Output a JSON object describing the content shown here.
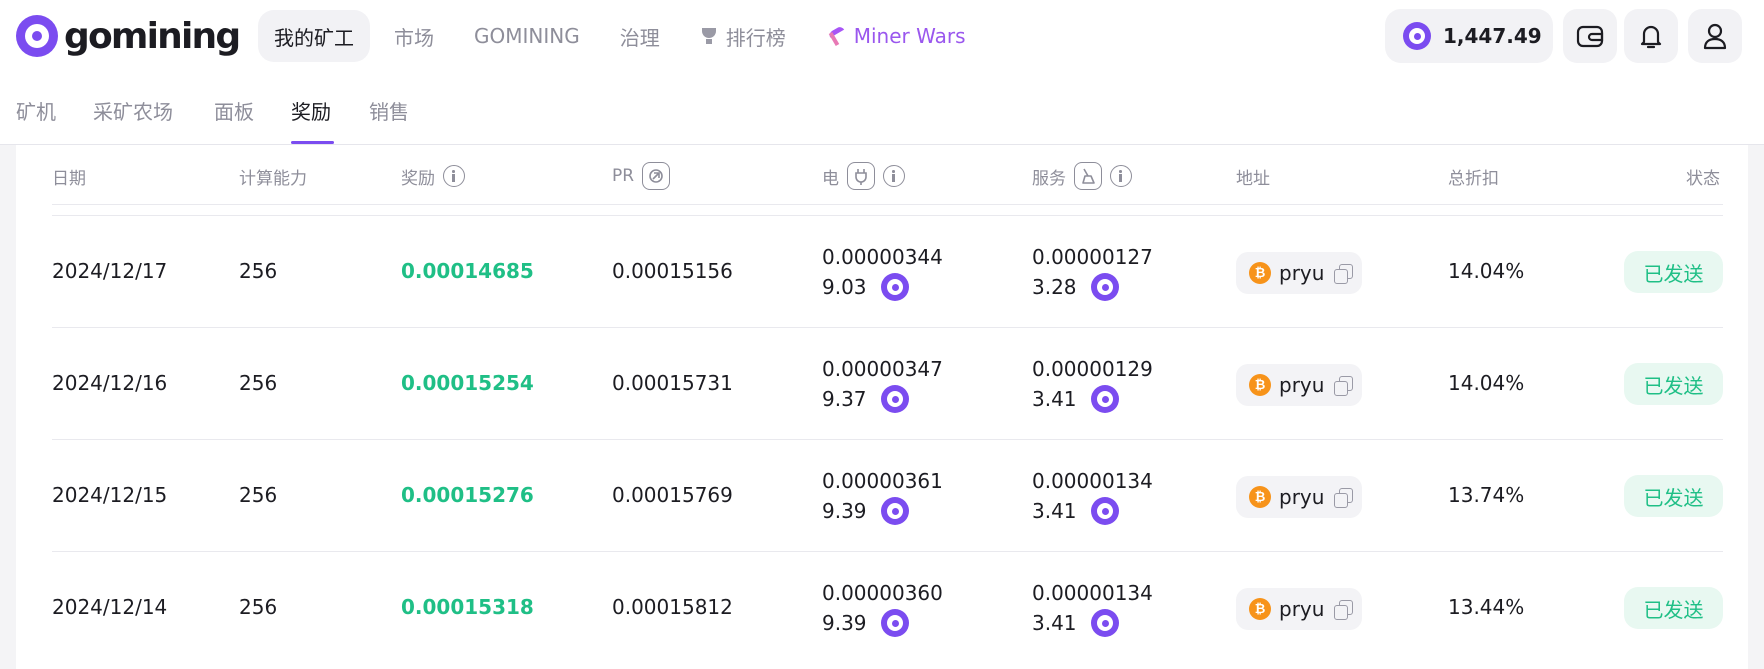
{
  "brand": {
    "name": "gomining"
  },
  "nav": {
    "items": [
      {
        "label": "我的矿工",
        "active": true
      },
      {
        "label": "市场"
      },
      {
        "label": "GOMINING"
      },
      {
        "label": "治理"
      },
      {
        "label": "排行榜",
        "icon": "trophy-icon"
      },
      {
        "label": "Miner Wars",
        "icon": "pickaxe-icon"
      }
    ]
  },
  "balance": {
    "value": "1,447.49",
    "icon": "gmt-coin-icon"
  },
  "header_buttons": [
    "wallet-icon",
    "bell-icon",
    "user-icon"
  ],
  "subnav": {
    "tabs": [
      {
        "label": "矿机"
      },
      {
        "label": "采矿农场"
      },
      {
        "label": "面板"
      },
      {
        "label": "奖励",
        "active": true
      },
      {
        "label": "销售"
      }
    ]
  },
  "table": {
    "headers": {
      "date": "日期",
      "power": "计算能力",
      "reward": "奖励",
      "pr": "PR",
      "electricity": "电",
      "service": "服务",
      "address": "地址",
      "discount": "总折扣",
      "status": "状态"
    },
    "rows": [
      {
        "date": "2024/12/17",
        "power": "256",
        "reward": "0.00014685",
        "pr": "0.00015156",
        "elec_btc": "0.00000344",
        "elec_gmt": "9.03",
        "svc_btc": "0.00000127",
        "svc_gmt": "3.28",
        "address": "pryu",
        "discount": "14.04%",
        "status": "已发送"
      },
      {
        "date": "2024/12/16",
        "power": "256",
        "reward": "0.00015254",
        "pr": "0.00015731",
        "elec_btc": "0.00000347",
        "elec_gmt": "9.37",
        "svc_btc": "0.00000129",
        "svc_gmt": "3.41",
        "address": "pryu",
        "discount": "14.04%",
        "status": "已发送"
      },
      {
        "date": "2024/12/15",
        "power": "256",
        "reward": "0.00015276",
        "pr": "0.00015769",
        "elec_btc": "0.00000361",
        "elec_gmt": "9.39",
        "svc_btc": "0.00000134",
        "svc_gmt": "3.41",
        "address": "pryu",
        "discount": "13.74%",
        "status": "已发送"
      },
      {
        "date": "2024/12/14",
        "power": "256",
        "reward": "0.00015318",
        "pr": "0.00015812",
        "elec_btc": "0.00000360",
        "elec_gmt": "9.39",
        "svc_btc": "0.00000134",
        "svc_gmt": "3.41",
        "address": "pryu",
        "discount": "13.44%",
        "status": "已发送"
      }
    ]
  },
  "colors": {
    "accent": "#7b4cf0",
    "reward_green": "#1fbf86",
    "status_bg": "#e8f8f1",
    "bitcoin": "#f7931a",
    "miner_wars": "#9a57ee"
  }
}
